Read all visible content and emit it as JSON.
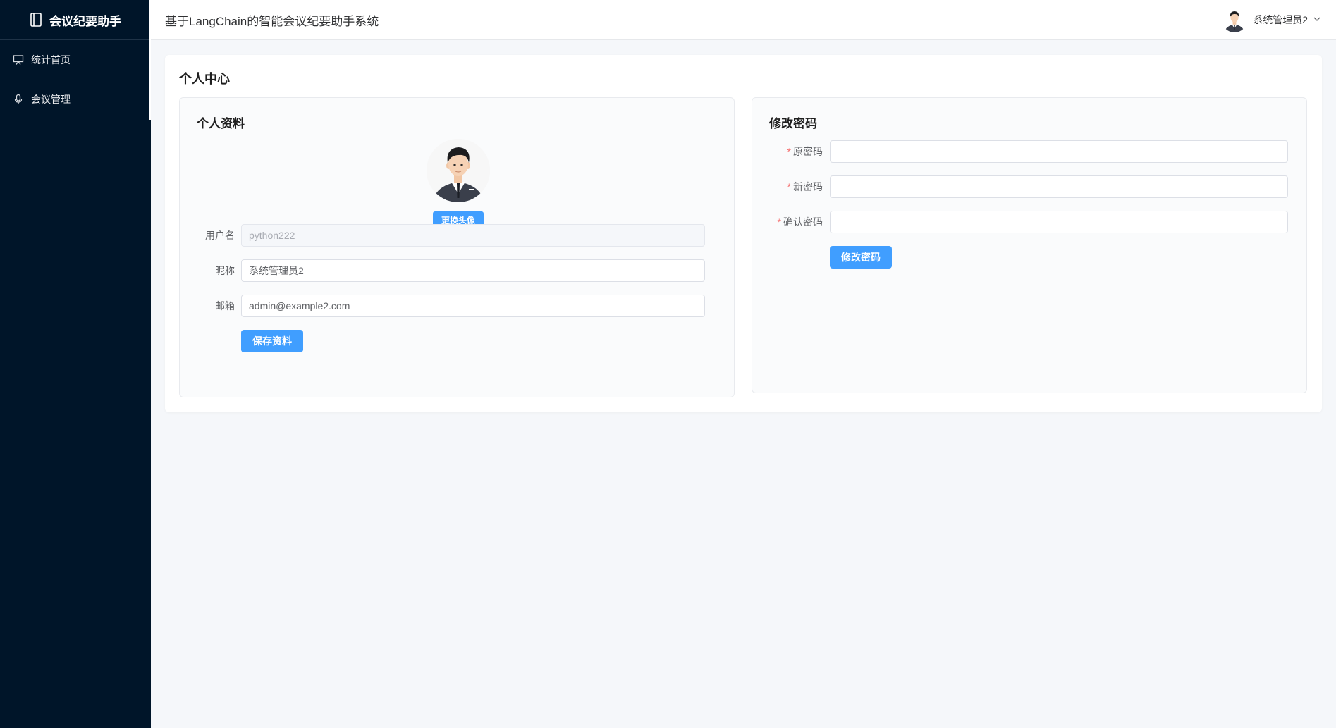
{
  "sidebar": {
    "brand_title": "会议纪要助手",
    "items": [
      {
        "label": "统计首页",
        "icon": "presentation-icon"
      },
      {
        "label": "会议管理",
        "icon": "microphone-icon"
      }
    ]
  },
  "header": {
    "title": "基于LangChain的智能会议纪要助手系统",
    "user_name": "系统管理员2"
  },
  "page": {
    "title": "个人中心"
  },
  "profile": {
    "title": "个人资料",
    "change_avatar_label": "更换头像",
    "username_label": "用户名",
    "username_value": "python222",
    "nickname_label": "昵称",
    "nickname_value": "系统管理员2",
    "email_label": "邮箱",
    "email_value": "admin@example2.com",
    "save_label": "保存资料"
  },
  "password": {
    "title": "修改密码",
    "required_mark": "*",
    "old_label": "原密码",
    "new_label": "新密码",
    "confirm_label": "确认密码",
    "submit_label": "修改密码"
  },
  "colors": {
    "sidebar_bg": "#001529",
    "primary": "#409eff",
    "required": "#f56c6c"
  }
}
